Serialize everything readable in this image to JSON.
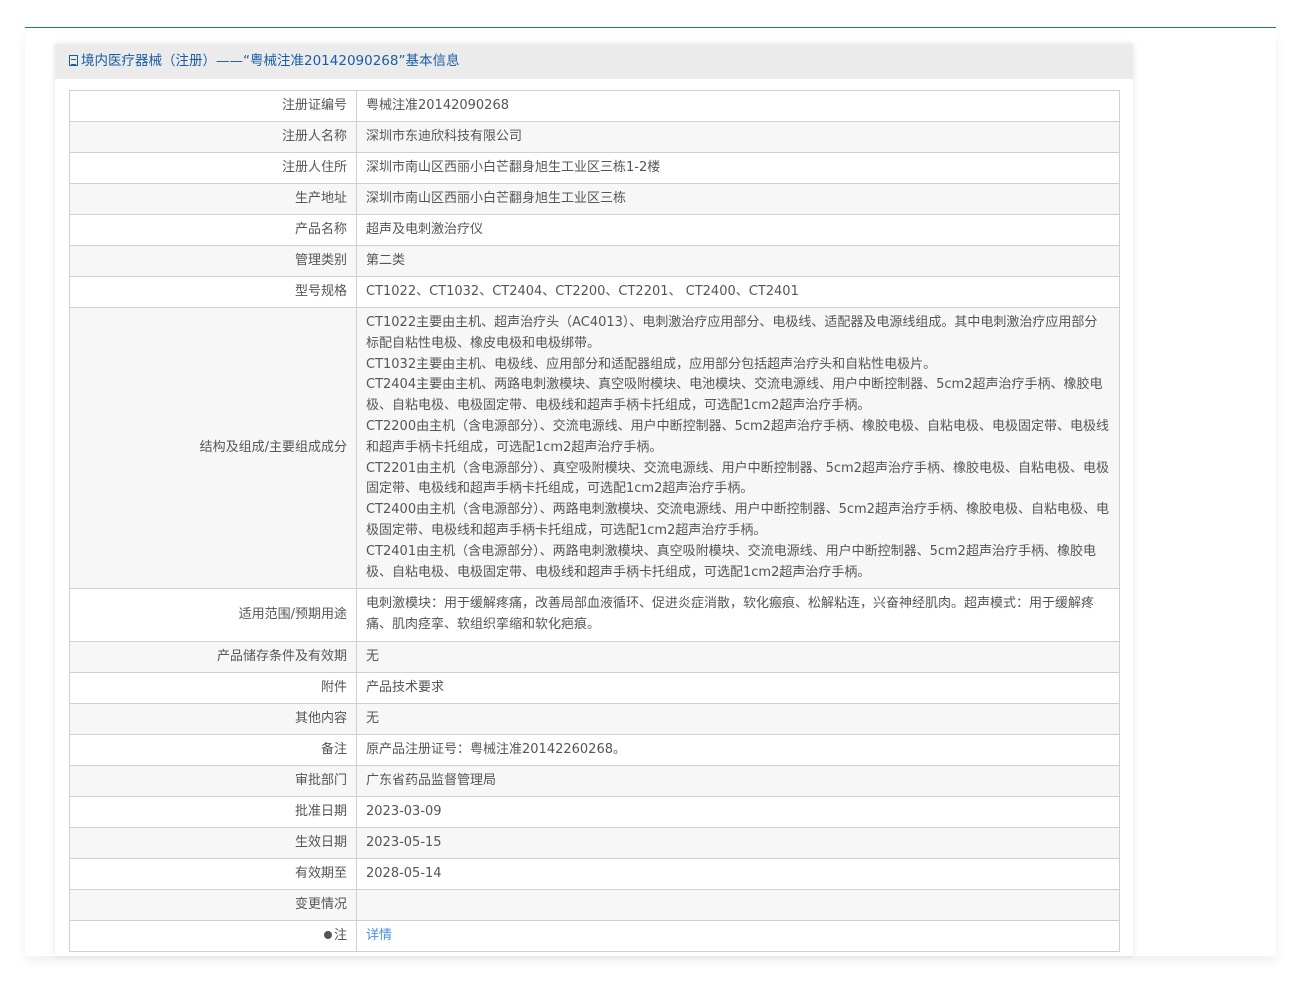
{
  "header": {
    "title": "境内医疗器械（注册）——“粤械注准20142090268”基本信息",
    "icon": "document-icon"
  },
  "rows": [
    {
      "label": "注册证编号",
      "value": "粤械注准20142090268"
    },
    {
      "label": "注册人名称",
      "value": "深圳市东迪欣科技有限公司"
    },
    {
      "label": "注册人住所",
      "value": "深圳市南山区西丽小白芒翻身旭生工业区三栋1-2楼"
    },
    {
      "label": "生产地址",
      "value": "深圳市南山区西丽小白芒翻身旭生工业区三栋"
    },
    {
      "label": "产品名称",
      "value": "超声及电刺激治疗仪"
    },
    {
      "label": "管理类别",
      "value": "第二类"
    },
    {
      "label": "型号规格",
      "value": "CT1022、CT1032、CT2404、CT2200、CT2201、 CT2400、CT2401"
    },
    {
      "label": "结构及组成/主要组成成分",
      "lines": [
        "CT1022主要由主机、超声治疗头（AC4013）、电刺激治疗应用部分、电极线、适配器及电源线组成。其中电刺激治疗应用部分标配自粘性电极、橡皮电极和电极绑带。",
        "CT1032主要由主机、电极线、应用部分和适配器组成，应用部分包括超声治疗头和自粘性电极片。",
        "CT2404主要由主机、两路电刺激模块、真空吸附模块、电池模块、交流电源线、用户中断控制器、5cm2超声治疗手柄、橡胶电极、自粘电极、电极固定带、电极线和超声手柄卡托组成，可选配1cm2超声治疗手柄。",
        "CT2200由主机（含电源部分）、交流电源线、用户中断控制器、5cm2超声治疗手柄、橡胶电极、自粘电极、电极固定带、电极线和超声手柄卡托组成，可选配1cm2超声治疗手柄。",
        "CT2201由主机（含电源部分）、真空吸附模块、交流电源线、用户中断控制器、5cm2超声治疗手柄、橡胶电极、自粘电极、电极固定带、电极线和超声手柄卡托组成，可选配1cm2超声治疗手柄。",
        "CT2400由主机（含电源部分）、两路电刺激模块、交流电源线、用户中断控制器、5cm2超声治疗手柄、橡胶电极、自粘电极、电极固定带、电极线和超声手柄卡托组成，可选配1cm2超声治疗手柄。",
        "CT2401由主机（含电源部分）、两路电刺激模块、真空吸附模块、交流电源线、用户中断控制器、5cm2超声治疗手柄、橡胶电极、自粘电极、电极固定带、电极线和超声手柄卡托组成，可选配1cm2超声治疗手柄。"
      ]
    },
    {
      "label": "适用范围/预期用途",
      "value": "电刺激模块：用于缓解疼痛，改善局部血液循环、促进炎症消散，软化瘢痕、松解粘连，兴奋神经肌肉。超声模式：用于缓解疼痛、肌肉痉挛、软组织挛缩和软化疤痕。"
    },
    {
      "label": "产品储存条件及有效期",
      "value": "无"
    },
    {
      "label": "附件",
      "value": "产品技术要求"
    },
    {
      "label": "其他内容",
      "value": "无"
    },
    {
      "label": "备注",
      "value": "原产品注册证号：粤械注准20142260268。"
    },
    {
      "label": "审批部门",
      "value": "广东省药品监督管理局"
    },
    {
      "label": "批准日期",
      "value": "2023-03-09"
    },
    {
      "label": "生效日期",
      "value": "2023-05-15"
    },
    {
      "label": "有效期至",
      "value": "2028-05-14"
    },
    {
      "label": "变更情况",
      "value": ""
    },
    {
      "label": "注",
      "value": "详情",
      "icon": "pin-icon"
    }
  ],
  "colors": {
    "accent": "#1a5ca8",
    "link": "#4a8fe0",
    "topline": "#1a6fc9"
  }
}
